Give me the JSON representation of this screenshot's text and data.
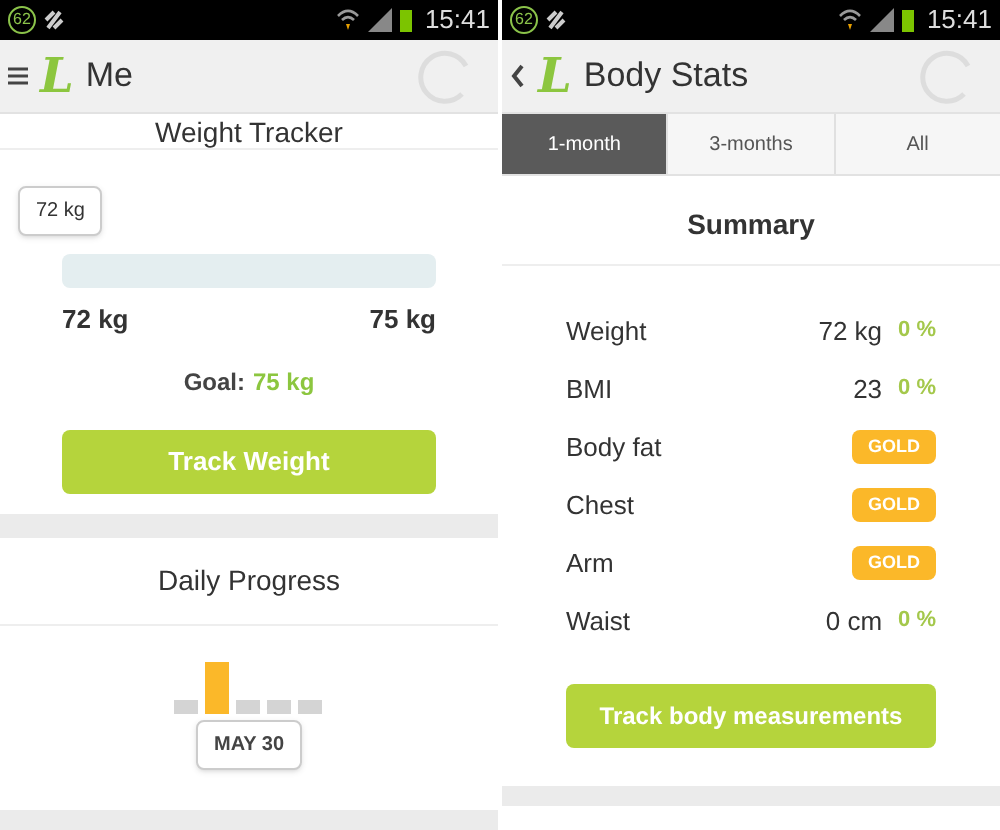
{
  "screens": [
    {
      "status_bar": {
        "notification": "62",
        "time": "15:41"
      },
      "header": {
        "back": false,
        "logo": "L",
        "title": "Me"
      },
      "weight_tracker": {
        "title": "Weight Tracker",
        "tooltip": "72 kg",
        "start": "72 kg",
        "end": "75 kg",
        "goal_label": "Goal:",
        "goal_value": "75 kg",
        "button": "Track Weight"
      },
      "daily_progress": {
        "title": "Daily Progress",
        "bars": [
          {
            "selected": false
          },
          {
            "selected": true
          },
          {
            "selected": false
          },
          {
            "selected": false
          },
          {
            "selected": false
          }
        ],
        "tooltip": "MAY 30"
      }
    },
    {
      "status_bar": {
        "notification": "62",
        "time": "15:41"
      },
      "header": {
        "back": true,
        "logo": "L",
        "title": "Body Stats"
      },
      "tabs": [
        {
          "label": "1-month",
          "selected": true
        },
        {
          "label": "3-months",
          "selected": false
        },
        {
          "label": "All",
          "selected": false
        }
      ],
      "summary": {
        "title": "Summary",
        "rows": [
          {
            "kind": "value",
            "label": "Weight",
            "value": "72 kg",
            "change": "0 %"
          },
          {
            "kind": "value",
            "label": "BMI",
            "value": "23",
            "change": "0 %"
          },
          {
            "kind": "badge",
            "label": "Body fat",
            "badge": "GOLD"
          },
          {
            "kind": "badge",
            "label": "Chest",
            "badge": "GOLD"
          },
          {
            "kind": "badge",
            "label": "Arm",
            "badge": "GOLD"
          },
          {
            "kind": "value",
            "label": "Waist",
            "value": "0 cm",
            "change": "0 %"
          }
        ],
        "button": "Track body measurements"
      }
    }
  ]
}
